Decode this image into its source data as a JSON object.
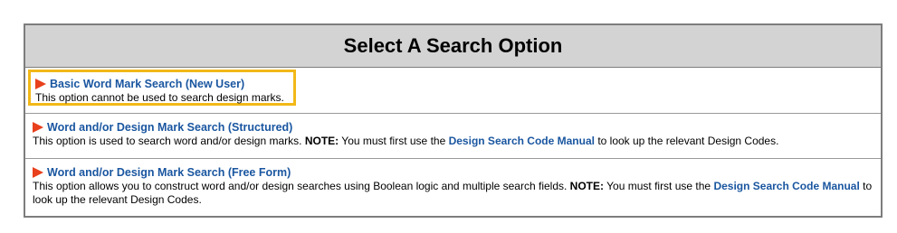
{
  "panel": {
    "title": "Select A Search Option"
  },
  "options": [
    {
      "link_label": "Basic Word Mark Search (New User)",
      "description": "This option cannot be used to search design marks."
    },
    {
      "link_label": "Word and/or Design Mark Search (Structured)",
      "description": "This option is used to search word and/or design marks.",
      "note_label": "NOTE:",
      "note_text_before": "You must first use the",
      "note_link_label": "Design Search Code Manual",
      "note_text_after": "to look up the relevant Design Codes."
    },
    {
      "link_label": "Word and/or Design Mark Search (Free Form)",
      "description": "This option allows you to construct word and/or design searches using Boolean logic and multiple search fields.",
      "note_label": "NOTE:",
      "note_text_before": "You must first use the",
      "note_link_label": "Design Search Code Manual",
      "note_text_after": "to look up the relevant Design Codes."
    }
  ],
  "colors": {
    "header_bg": "#d3d3d3",
    "link": "#1a56a0",
    "flag": "#e8401c",
    "highlight": "#f2b818",
    "border": "#7d7d7d"
  },
  "icons": {
    "option_marker": "red-flag-icon"
  }
}
